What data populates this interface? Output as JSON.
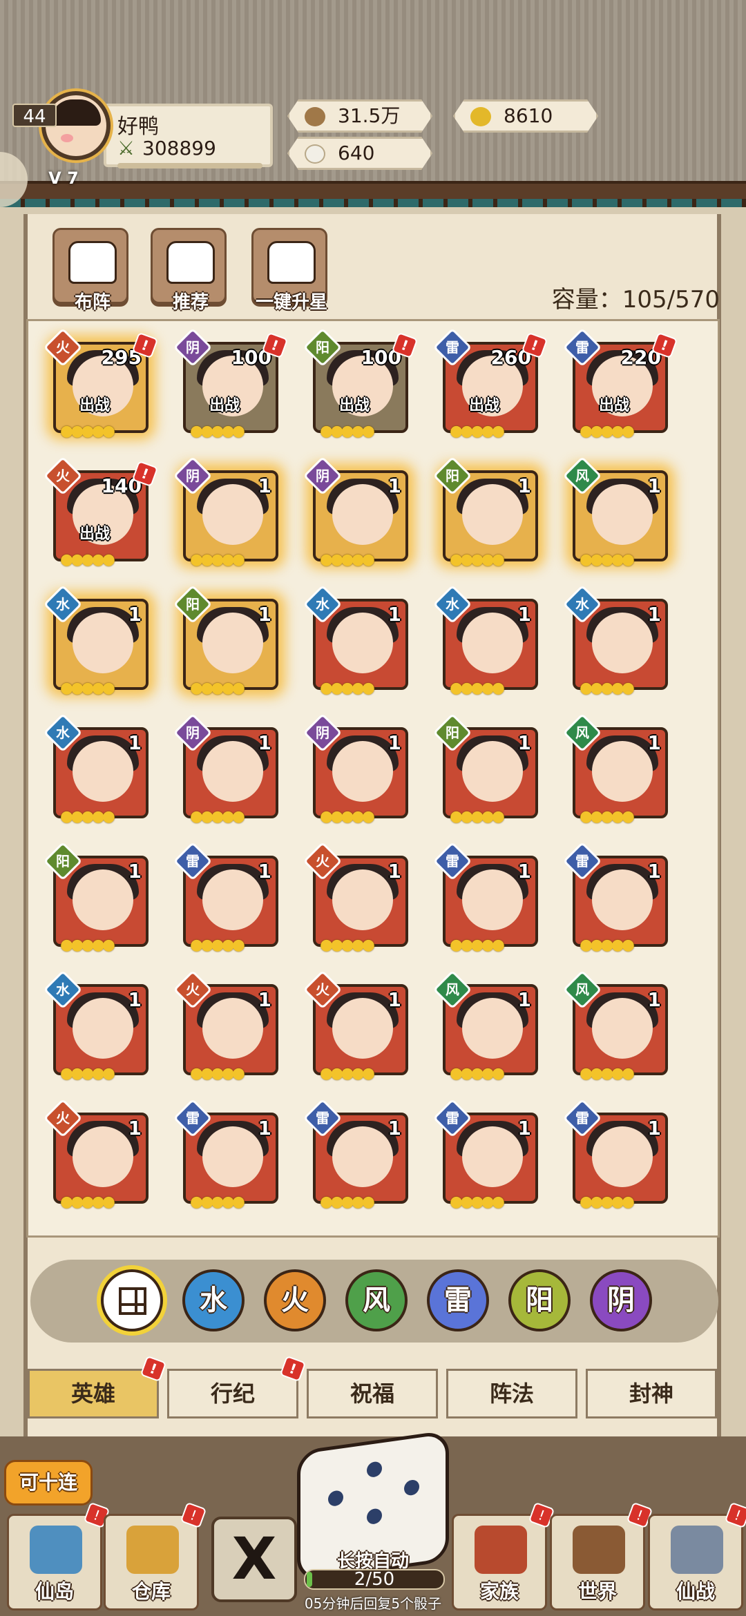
{
  "player": {
    "level": "44",
    "vip": "V 7",
    "name": "好鸭",
    "power_icon": "crossed-swords-icon",
    "power": "308899"
  },
  "currency": {
    "coins": "31.5万",
    "gold": "8610",
    "rice": "640"
  },
  "actions": {
    "formation": "布阵",
    "recommend": "推荐",
    "upgrade_all": "一键升星"
  },
  "capacity": {
    "label": "容量：",
    "value": "105/570"
  },
  "heroes": [
    {
      "elem": "火",
      "level": "295",
      "battle": "出战",
      "style": "gold",
      "alert": true
    },
    {
      "elem": "阴",
      "level": "100",
      "battle": "出战",
      "style": "grey",
      "alert": true
    },
    {
      "elem": "阳",
      "level": "100",
      "battle": "出战",
      "style": "grey",
      "alert": true
    },
    {
      "elem": "雷",
      "level": "260",
      "battle": "出战",
      "style": "red",
      "alert": true
    },
    {
      "elem": "雷",
      "level": "220",
      "battle": "出战",
      "style": "red",
      "alert": true
    },
    {
      "elem": "火",
      "level": "140",
      "battle": "出战",
      "style": "red",
      "alert": true
    },
    {
      "elem": "阴",
      "level": "1",
      "battle": "",
      "style": "gold",
      "alert": false
    },
    {
      "elem": "阴",
      "level": "1",
      "battle": "",
      "style": "gold",
      "alert": false
    },
    {
      "elem": "阳",
      "level": "1",
      "battle": "",
      "style": "gold",
      "alert": false
    },
    {
      "elem": "风",
      "level": "1",
      "battle": "",
      "style": "gold",
      "alert": false
    },
    {
      "elem": "水",
      "level": "1",
      "battle": "",
      "style": "gold",
      "alert": false
    },
    {
      "elem": "阳",
      "level": "1",
      "battle": "",
      "style": "gold",
      "alert": false
    },
    {
      "elem": "水",
      "level": "1",
      "battle": "",
      "style": "red",
      "alert": false
    },
    {
      "elem": "水",
      "level": "1",
      "battle": "",
      "style": "red",
      "alert": false
    },
    {
      "elem": "水",
      "level": "1",
      "battle": "",
      "style": "red",
      "alert": false
    },
    {
      "elem": "水",
      "level": "1",
      "battle": "",
      "style": "red",
      "alert": false
    },
    {
      "elem": "阴",
      "level": "1",
      "battle": "",
      "style": "red",
      "alert": false
    },
    {
      "elem": "阴",
      "level": "1",
      "battle": "",
      "style": "red",
      "alert": false
    },
    {
      "elem": "阳",
      "level": "1",
      "battle": "",
      "style": "red",
      "alert": false
    },
    {
      "elem": "风",
      "level": "1",
      "battle": "",
      "style": "red",
      "alert": false
    },
    {
      "elem": "阳",
      "level": "1",
      "battle": "",
      "style": "red",
      "alert": false
    },
    {
      "elem": "雷",
      "level": "1",
      "battle": "",
      "style": "red",
      "alert": false
    },
    {
      "elem": "火",
      "level": "1",
      "battle": "",
      "style": "red",
      "alert": false
    },
    {
      "elem": "雷",
      "level": "1",
      "battle": "",
      "style": "red",
      "alert": false
    },
    {
      "elem": "雷",
      "level": "1",
      "battle": "",
      "style": "red",
      "alert": false
    },
    {
      "elem": "水",
      "level": "1",
      "battle": "",
      "style": "red",
      "alert": false
    },
    {
      "elem": "火",
      "level": "1",
      "battle": "",
      "style": "red",
      "alert": false
    },
    {
      "elem": "火",
      "level": "1",
      "battle": "",
      "style": "red",
      "alert": false
    },
    {
      "elem": "风",
      "level": "1",
      "battle": "",
      "style": "red",
      "alert": false
    },
    {
      "elem": "风",
      "level": "1",
      "battle": "",
      "style": "red",
      "alert": false
    },
    {
      "elem": "火",
      "level": "1",
      "battle": "",
      "style": "red",
      "alert": false
    },
    {
      "elem": "雷",
      "level": "1",
      "battle": "",
      "style": "red",
      "alert": false
    },
    {
      "elem": "雷",
      "level": "1",
      "battle": "",
      "style": "red",
      "alert": false
    },
    {
      "elem": "雷",
      "level": "1",
      "battle": "",
      "style": "red",
      "alert": false
    },
    {
      "elem": "雷",
      "level": "1",
      "battle": "",
      "style": "red",
      "alert": false
    }
  ],
  "filters": [
    "水",
    "火",
    "风",
    "雷",
    "阳",
    "阴"
  ],
  "filter_colors": [
    "#3b8fd1",
    "#e08a2e",
    "#4fa04a",
    "#5a74d8",
    "#a6b83a",
    "#8a4ac0"
  ],
  "tabs": [
    {
      "label": "英雄",
      "active": true,
      "alert": true
    },
    {
      "label": "行纪",
      "active": false,
      "alert": true
    },
    {
      "label": "祝福",
      "active": false,
      "alert": false
    },
    {
      "label": "阵法",
      "active": false,
      "alert": false
    },
    {
      "label": "封神",
      "active": false,
      "alert": false
    }
  ],
  "ten_pull": "可十连",
  "dice": {
    "label": "长按自动",
    "count": "2/50",
    "progress": 0.04,
    "recover": "05分钟后回复5个骰子"
  },
  "nav": {
    "island": "仙岛",
    "warehouse": "仓库",
    "clan": "家族",
    "world": "世界",
    "battle": "仙战"
  },
  "colors": {
    "accent_gold": "#e9c564",
    "alert_red": "#d8322a"
  }
}
